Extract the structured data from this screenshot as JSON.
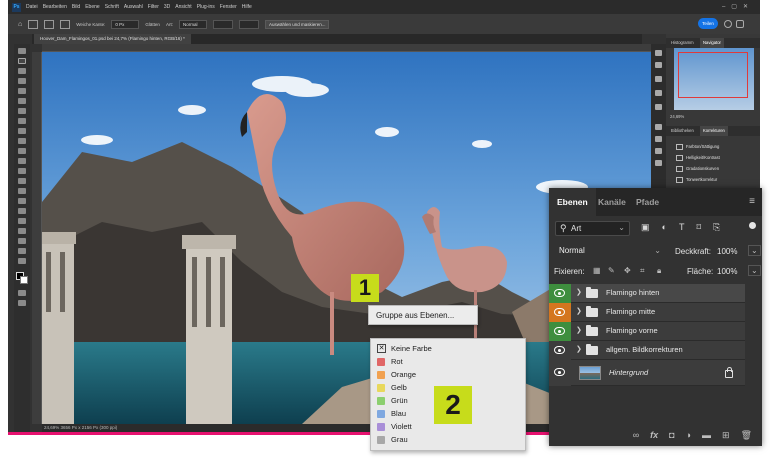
{
  "menubar": {
    "logo": "Ps",
    "items": [
      "Datei",
      "Bearbeiten",
      "Bild",
      "Ebene",
      "Schrift",
      "Auswahl",
      "Filter",
      "3D",
      "Ansicht",
      "Plug-ins",
      "Fenster",
      "Hilfe"
    ]
  },
  "options": {
    "soft_edge_label": "Weiche Kante:",
    "soft_edge_value": "0 Px",
    "smooth_label": "Glätten",
    "style_label": "Art:",
    "style_value": "Normal",
    "select_mask_label": "Auswählen und maskieren...",
    "share_label": "Teilen"
  },
  "document": {
    "tab_label": "Hoover_Dam_Flamingos_01.psd bei 24,7% (Flamingo hinten, RGB/16) *",
    "status": "24,69%     3656 Px x 2156 Px (300 ppi)"
  },
  "dock": {
    "tabs_top": [
      "Histogramm",
      "Navigator"
    ],
    "zoom": "24,69%",
    "tabs_adj": [
      "Bibliotheken",
      "Korrekturen"
    ],
    "adjustments": [
      "Farbton/Sättigung",
      "Helligkeit/Kontrast",
      "Gradationskurven",
      "Tonwertkorrektur",
      "Farbbalance"
    ]
  },
  "layers_panel": {
    "tabs": [
      "Ebenen",
      "Kanäle",
      "Pfade"
    ],
    "filter_value": "Art",
    "blend_mode": "Normal",
    "opacity_label": "Deckkraft:",
    "opacity_value": "100%",
    "lock_label": "Fixieren:",
    "fill_label": "Fläche:",
    "fill_value": "100%",
    "layers": [
      {
        "name": "Flamingo hinten",
        "tag_color": "#3e8e3e",
        "selected": true,
        "type": "group"
      },
      {
        "name": "Flamingo mitte",
        "tag_color": "#d4761f",
        "selected": false,
        "type": "group"
      },
      {
        "name": "Flamingo vorne",
        "tag_color": "#3e8e3e",
        "selected": false,
        "type": "group"
      },
      {
        "name": "allgem. Bildkorrekturen",
        "tag_color": "#3c3c3c",
        "selected": false,
        "type": "group"
      },
      {
        "name": "Hintergrund",
        "tag_color": "#3c3c3c",
        "selected": false,
        "type": "background"
      }
    ],
    "footer_icons": [
      "link-icon",
      "fx-icon",
      "mask-icon",
      "adjustment-icon",
      "folder-icon",
      "new-layer-icon",
      "trash-icon"
    ]
  },
  "context_menu_1": {
    "item": "Gruppe aus Ebenen..."
  },
  "context_menu_2": {
    "items": [
      {
        "label": "Keine Farbe",
        "color": "none"
      },
      {
        "label": "Rot",
        "color": "#e06666"
      },
      {
        "label": "Orange",
        "color": "#f1a150"
      },
      {
        "label": "Gelb",
        "color": "#e8d85c"
      },
      {
        "label": "Grün",
        "color": "#8ccf6f"
      },
      {
        "label": "Blau",
        "color": "#7fa8e0"
      },
      {
        "label": "Violett",
        "color": "#a98fd8"
      },
      {
        "label": "Grau",
        "color": "#a8a8a8"
      }
    ]
  },
  "badges": [
    "1",
    "2"
  ]
}
